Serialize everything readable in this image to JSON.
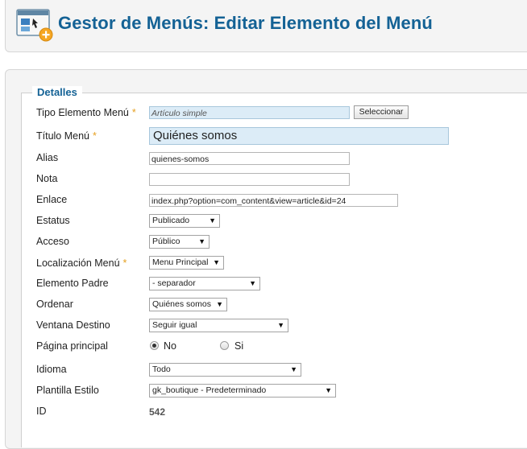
{
  "header": {
    "title": "Gestor de Menús: Editar Elemento del Menú"
  },
  "form": {
    "legend": "Detalles",
    "tipo": {
      "label": "Tipo Elemento Menú",
      "value": "Artículo simple",
      "button": "Seleccionar"
    },
    "titulo": {
      "label": "Título Menú",
      "value": "Quiénes somos"
    },
    "alias": {
      "label": "Alias",
      "value": "quienes-somos"
    },
    "nota": {
      "label": "Nota",
      "value": ""
    },
    "enlace": {
      "label": "Enlace",
      "value": "index.php?option=com_content&view=article&id=24"
    },
    "estatus": {
      "label": "Estatus",
      "value": "Publicado"
    },
    "acceso": {
      "label": "Acceso",
      "value": "Público"
    },
    "localizacion": {
      "label": "Localización Menú",
      "value": "Menu Principal"
    },
    "padre": {
      "label": "Elemento Padre",
      "value": "- separador"
    },
    "ordenar": {
      "label": "Ordenar",
      "value": "Quiénes somos"
    },
    "ventana": {
      "label": "Ventana Destino",
      "value": "Seguir igual"
    },
    "pagina": {
      "label": "Página principal",
      "options": [
        "No",
        "Si"
      ],
      "selected": "No"
    },
    "idioma": {
      "label": "Idioma",
      "value": "Todo"
    },
    "plantilla": {
      "label": "Plantilla Estilo",
      "value": "gk_boutique - Predeterminado"
    },
    "id": {
      "label": "ID",
      "value": "542"
    },
    "required_mark": "*"
  },
  "colors": {
    "title": "#146295",
    "required": "#e6a020",
    "readonly_bg": "#dcecf7"
  },
  "icons": {
    "header": "menu-manager-icon",
    "dropdown": "chevron-down-icon"
  }
}
